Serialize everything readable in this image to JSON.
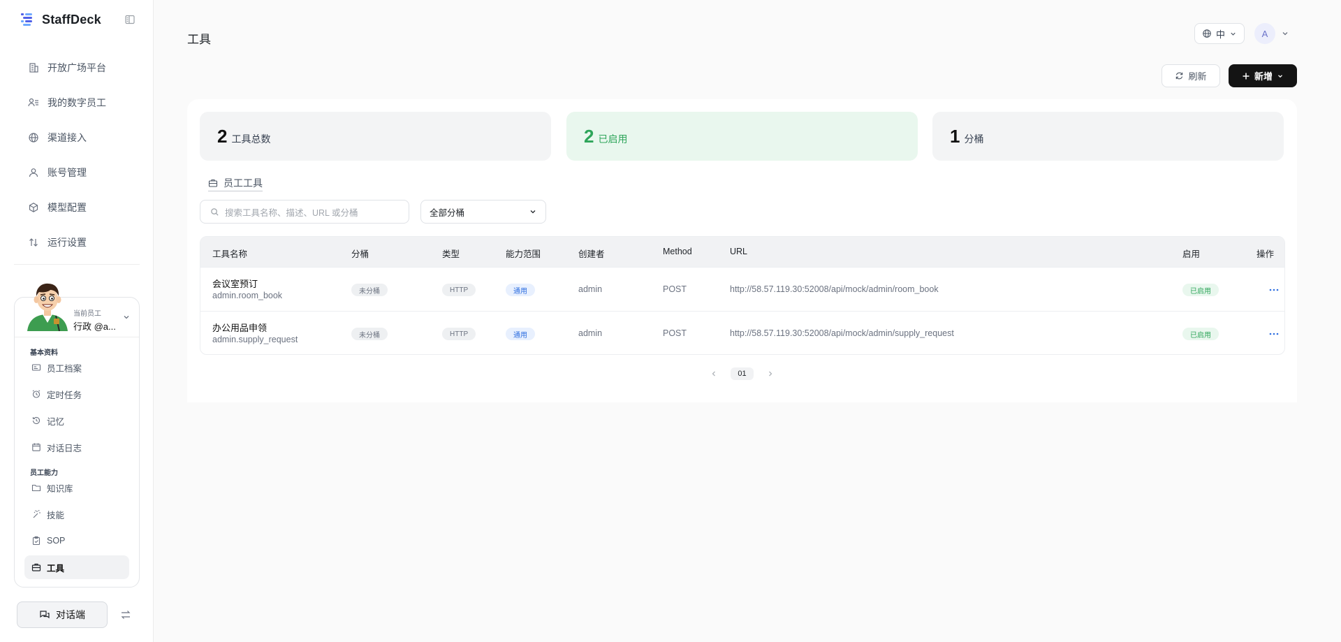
{
  "app": {
    "name": "StaffDeck"
  },
  "nav": [
    {
      "label": "开放广场平台",
      "icon": "building-icon"
    },
    {
      "label": "我的数字员工",
      "icon": "staff-list-icon"
    },
    {
      "label": "渠道接入",
      "icon": "globe-icon"
    },
    {
      "label": "账号管理",
      "icon": "user-icon"
    },
    {
      "label": "模型配置",
      "icon": "cube-icon"
    },
    {
      "label": "运行设置",
      "icon": "sort-arrows-icon"
    }
  ],
  "staff": {
    "role_label": "当前员工",
    "name": "行政 @a...",
    "groups": {
      "basic": "基本资料",
      "abilities": "员工能力"
    },
    "items": [
      {
        "label": "员工档案",
        "icon": "id-card-icon"
      },
      {
        "label": "定时任务",
        "icon": "alarm-clock-icon"
      },
      {
        "label": "记忆",
        "icon": "history-icon"
      },
      {
        "label": "对话日志",
        "icon": "calendar-icon"
      },
      {
        "label": "知识库",
        "icon": "folder-icon"
      },
      {
        "label": "技能",
        "icon": "wand-icon"
      },
      {
        "label": "SOP",
        "icon": "clipboard-icon"
      },
      {
        "label": "工具",
        "icon": "toolbox-icon"
      }
    ]
  },
  "footer": {
    "chat_button": "对话端"
  },
  "header": {
    "title": "工具",
    "language": "中",
    "user_initial": "A",
    "refresh_label": "刷新",
    "add_label": "新增"
  },
  "stats": [
    {
      "value": "2",
      "label": "工具总数"
    },
    {
      "value": "2",
      "label": "已启用"
    },
    {
      "value": "1",
      "label": "分桶"
    }
  ],
  "tab": {
    "label": "员工工具"
  },
  "filters": {
    "search_placeholder": "搜索工具名称、描述、URL 或分桶",
    "bucket_select": "全部分桶"
  },
  "table": {
    "columns": [
      "工具名称",
      "分桶",
      "类型",
      "能力范围",
      "创建者",
      "Method",
      "URL",
      "启用",
      "操作"
    ],
    "rows": [
      {
        "name": "会议室预订",
        "id": "admin.room_book",
        "bucket": "未分桶",
        "type": "HTTP",
        "scope": "通用",
        "creator": "admin",
        "method": "POST",
        "url": "http://58.57.119.30:52008/api/mock/admin/room_book",
        "enabled": "已启用"
      },
      {
        "name": "办公用品申领",
        "id": "admin.supply_request",
        "bucket": "未分桶",
        "type": "HTTP",
        "scope": "通用",
        "creator": "admin",
        "method": "POST",
        "url": "http://58.57.119.30:52008/api/mock/admin/supply_request",
        "enabled": "已启用"
      }
    ]
  },
  "pagination": {
    "current": "01"
  },
  "colors": {
    "primary": "#141414",
    "success": "#2ea55a",
    "info": "#2f6fe0",
    "brand_logo": "#4f5fe8"
  }
}
